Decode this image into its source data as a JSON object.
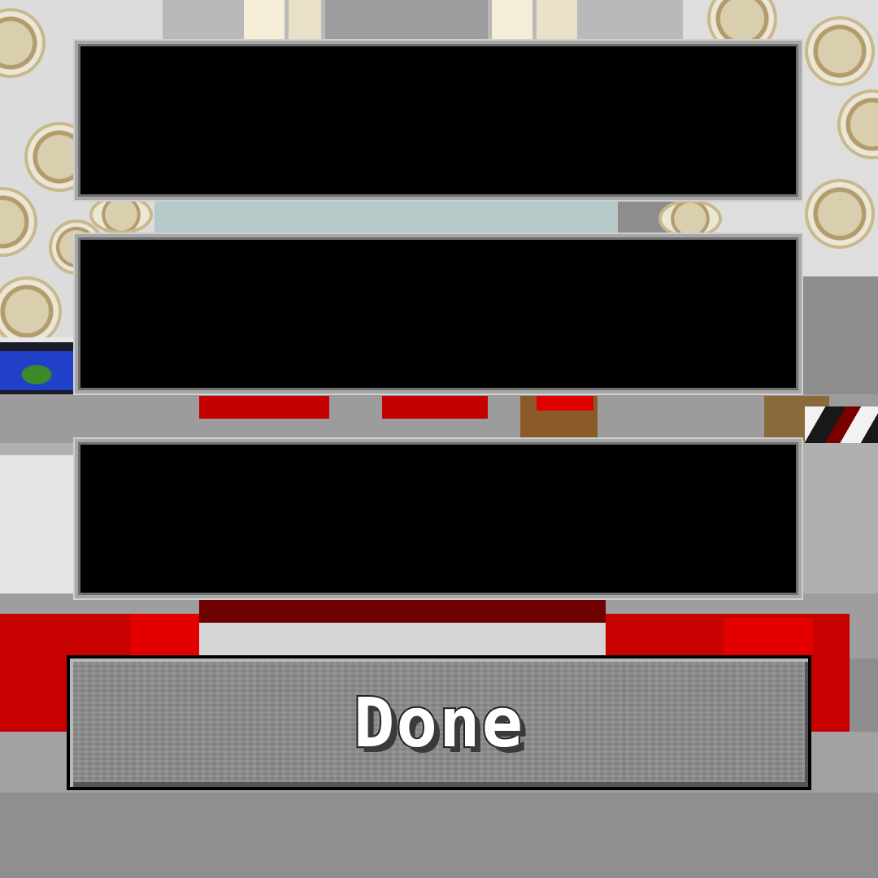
{
  "sign_editor": {
    "lines": [
      {
        "value": "",
        "placeholder": ""
      },
      {
        "value": "",
        "placeholder": ""
      },
      {
        "value": "",
        "placeholder": ""
      }
    ],
    "done_label": "Done"
  },
  "colors": {
    "field_bg": "#000000",
    "field_border": "#a7a7a7",
    "button_bg": "#8c8c8c",
    "button_text": "#ffffff",
    "scene_red": "#c80000"
  }
}
